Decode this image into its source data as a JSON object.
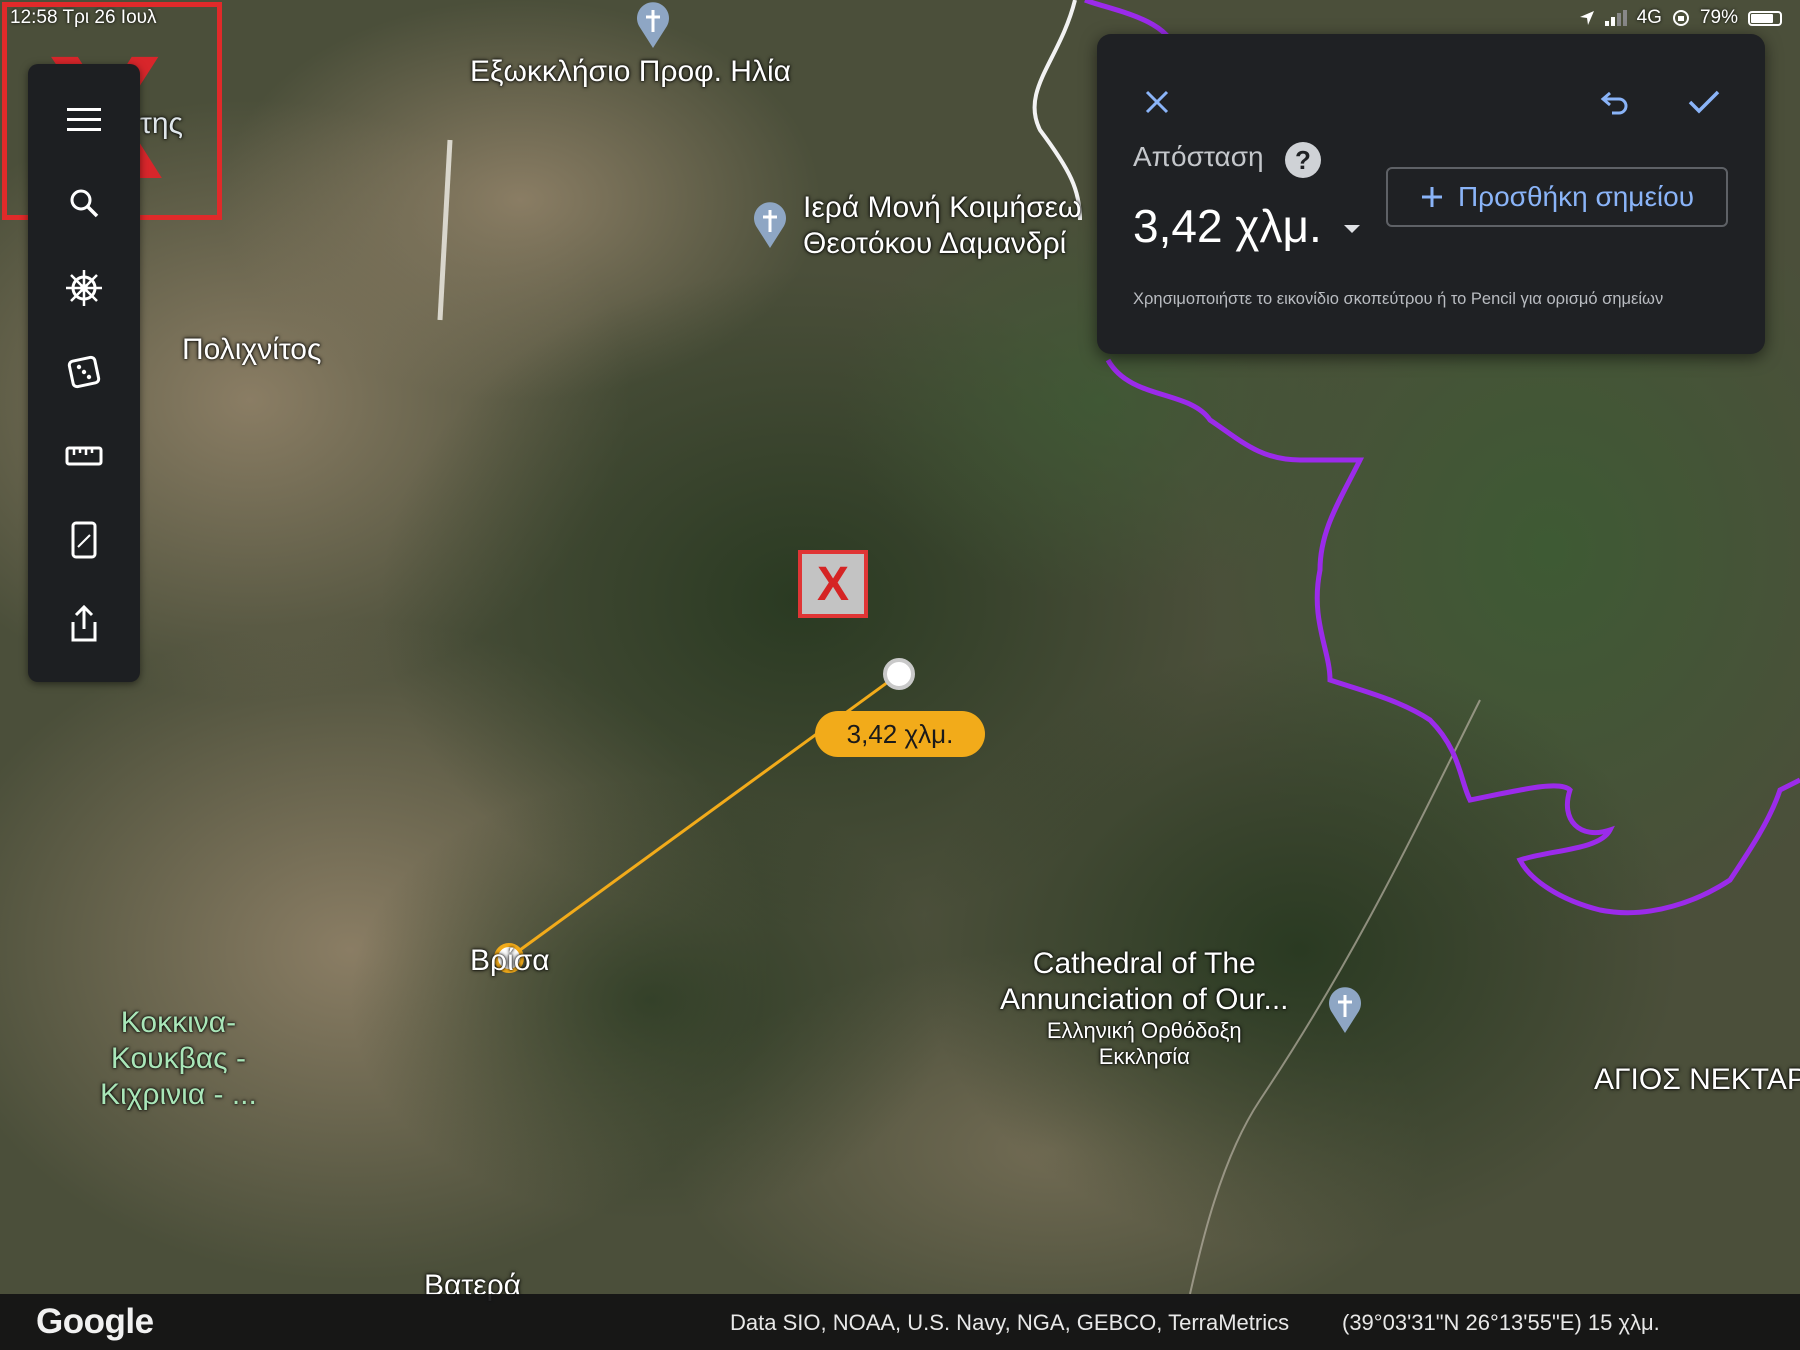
{
  "status_bar": {
    "time_date": "12:58   Τρι 26 Ιουλ",
    "network": "4G",
    "battery": "79%",
    "battery_fraction": 0.79
  },
  "toolbar": {
    "items": [
      {
        "name": "menu-icon"
      },
      {
        "name": "search-icon"
      },
      {
        "name": "voyager-wheel-icon"
      },
      {
        "name": "dice-icon"
      },
      {
        "name": "ruler-icon"
      },
      {
        "name": "device-icon"
      },
      {
        "name": "share-icon"
      }
    ]
  },
  "corner_mark": {
    "text": "X",
    "underlying_label": "της"
  },
  "map": {
    "labels": {
      "chapel": "Εξωκκλήσιο Προφ. Ηλία",
      "monastery_line1": "Ιερά Μονή Κοιμήσεω",
      "monastery_line2": "Θεοτόκου Δαμανδρί",
      "polichnitos": "Πολιχνίτος",
      "vrisa": "Βρίσα",
      "kokkina_line1": "Κοκκινα-",
      "kokkina_line2": "Κουκβας -",
      "kokkina_line3": "Κιχρινια - ...",
      "cathedral_line1": "Cathedral of The",
      "cathedral_line2": "Annunciation of Our...",
      "cathedral_sub1": "Ελληνική Ορθόδοξη",
      "cathedral_sub2": "Εκκλησία",
      "agios": "ΑΓΙΟΣ ΝΕΚΤΑΡ",
      "vatera": "Βατερά"
    },
    "x_marker": "X",
    "measure_badge": "3,42 χλμ."
  },
  "panel": {
    "label": "Απόσταση",
    "help": "?",
    "value": "3,42 χλμ.",
    "add_point": "Προσθήκη σημείου",
    "hint": "Χρησιμοποιήστε το εικονίδιο σκοπεύτρου ή το Pencil για ορισμό σημείων"
  },
  "bottom_bar": {
    "logo": "Google",
    "attribution": "Data SIO, NOAA, U.S. Navy, NGA, GEBCO, TerraMetrics",
    "coords": "(39°03'31\"N 26°13'55\"E) 15 χλμ."
  },
  "colors": {
    "measure_line": "#f2ab1a",
    "boundary": "#9b2bea",
    "accent_blue": "#8ab4f8",
    "marker_red": "#e03535"
  }
}
